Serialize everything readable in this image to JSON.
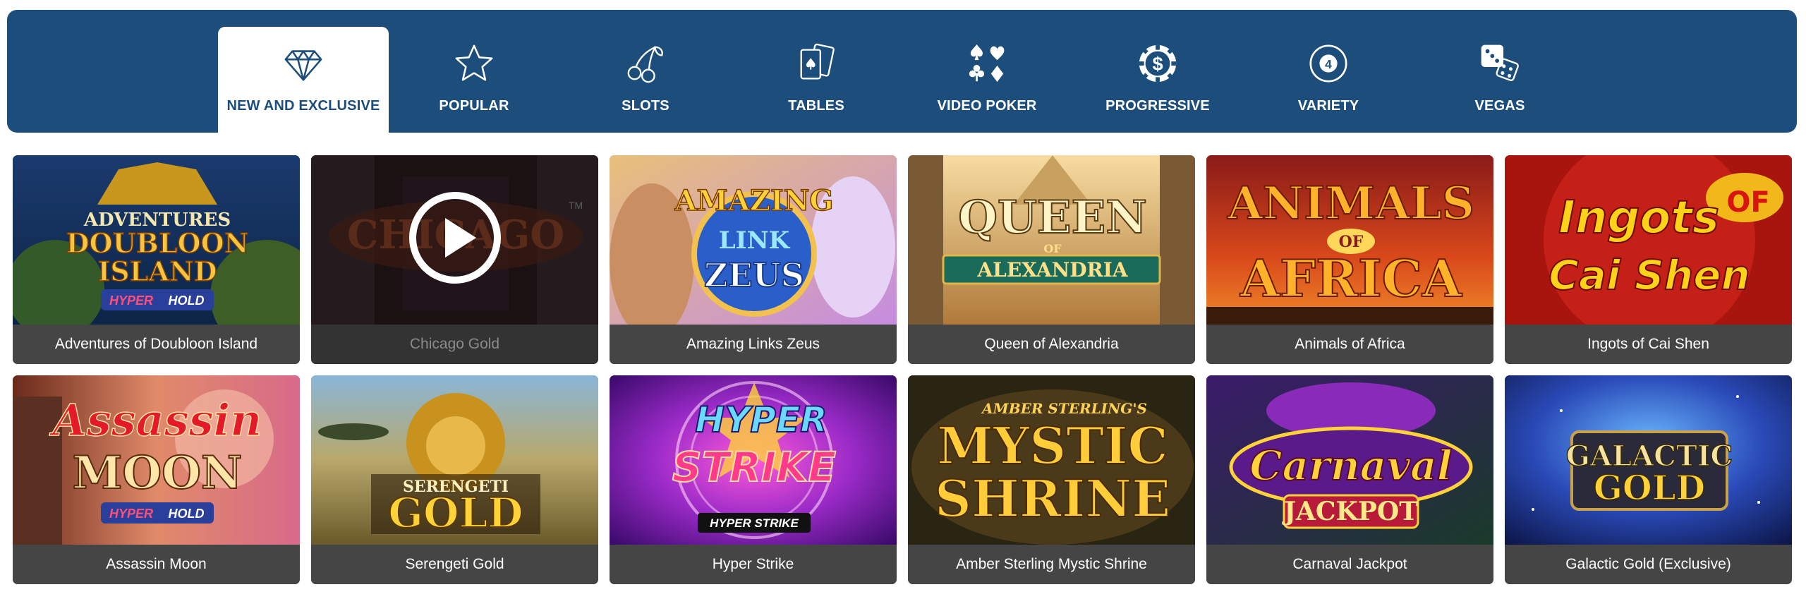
{
  "nav": {
    "tabs": [
      {
        "label": "NEW AND EXCLUSIVE",
        "icon": "diamond-icon",
        "active": true
      },
      {
        "label": "POPULAR",
        "icon": "star-icon",
        "active": false
      },
      {
        "label": "SLOTS",
        "icon": "cherries-icon",
        "active": false
      },
      {
        "label": "TABLES",
        "icon": "playing-cards-icon",
        "active": false
      },
      {
        "label": "VIDEO POKER",
        "icon": "card-suits-icon",
        "active": false
      },
      {
        "label": "PROGRESSIVE",
        "icon": "casino-chip-dollar-icon",
        "active": false
      },
      {
        "label": "VARIETY",
        "icon": "pool-ball-4-icon",
        "active": false
      },
      {
        "label": "VEGAS",
        "icon": "dice-icon",
        "active": false
      }
    ]
  },
  "games": [
    {
      "title": "Adventures of Doubloon Island",
      "art": [
        "ADVENTURES",
        "DOUBLOON",
        "ISLAND",
        "HYPER",
        "HOLD"
      ]
    },
    {
      "title": "Chicago Gold",
      "art": [
        "CHICAGO",
        "TM"
      ]
    },
    {
      "title": "Amazing Links Zeus",
      "art": [
        "AMAZING",
        "LINK",
        "ZEUS"
      ]
    },
    {
      "title": "Queen of Alexandria",
      "art": [
        "QUEEN",
        "OF",
        "ALEXANDRIA"
      ]
    },
    {
      "title": "Animals of Africa",
      "art": [
        "ANIMALS",
        "OF",
        "AFRICA"
      ]
    },
    {
      "title": "Ingots of Cai Shen",
      "art": [
        "Ingots",
        "OF",
        "Cai Shen"
      ]
    },
    {
      "title": "Assassin Moon",
      "art": [
        "Assassin",
        "MOON",
        "HYPER",
        "HOLD"
      ]
    },
    {
      "title": "Serengeti Gold",
      "art": [
        "SERENGETI",
        "GOLD"
      ]
    },
    {
      "title": "Hyper Strike",
      "art": [
        "HYPER",
        "STRIKE",
        "HYPER STRIKE"
      ]
    },
    {
      "title": "Amber Sterling Mystic Shrine",
      "art": [
        "AMBER STERLING'S",
        "MYSTIC",
        "SHRINE"
      ]
    },
    {
      "title": "Carnaval Jackpot",
      "art": [
        "Carnaval",
        "JACKPOT"
      ]
    },
    {
      "title": "Galactic Gold (Exclusive)",
      "art": [
        "GALACTIC",
        "GOLD"
      ]
    }
  ],
  "colors": {
    "nav_bg": "#1d4e7b",
    "caption_bg": "#454545",
    "active_tab_bg": "#ffffff"
  }
}
